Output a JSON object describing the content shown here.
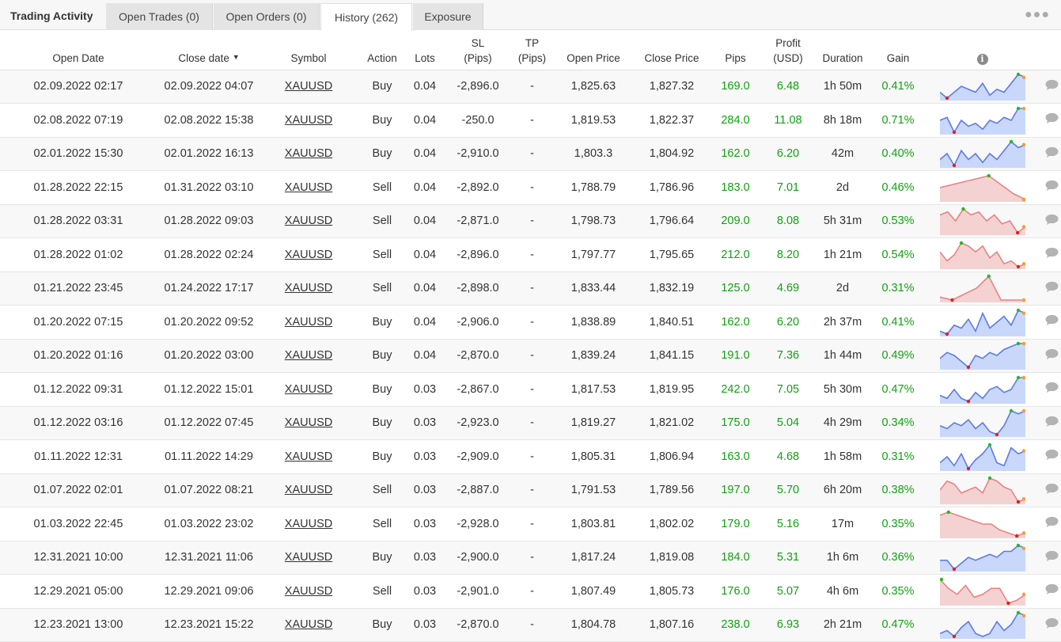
{
  "brand": "Trading Activity",
  "tabs": [
    {
      "label": "Open Trades (0)"
    },
    {
      "label": "Open Orders (0)"
    },
    {
      "label": "History (262)"
    },
    {
      "label": "Exposure"
    }
  ],
  "menu_icon": "more-horizontal-icon",
  "headers": {
    "open_date": "Open Date",
    "close_date": "Close date",
    "sort_indicator": "▼",
    "symbol": "Symbol",
    "action": "Action",
    "lots": "Lots",
    "sl": "SL",
    "sl_unit": "(Pips)",
    "tp": "TP",
    "tp_unit": "(Pips)",
    "open_price": "Open Price",
    "close_price": "Close Price",
    "pips": "Pips",
    "profit": "Profit",
    "profit_unit": "(USD)",
    "duration": "Duration",
    "gain": "Gain",
    "info": "i"
  },
  "colors": {
    "profit_green": "#12a012",
    "buy_line": "#5b7be8",
    "buy_fill": "#c9d7fb",
    "sell_line": "#e88383",
    "sell_fill": "#f4d2d2",
    "max_dot": "#22bb22",
    "min_dot": "#e02020",
    "end_dot": "#ff9933",
    "chat_icon": "#b3b3b3"
  },
  "rows": [
    {
      "open": "02.09.2022 02:17",
      "close": "02.09.2022 04:07",
      "symbol": "XAUUSD",
      "action": "Buy",
      "lots": "0.04",
      "sl": "-2,896.0",
      "tp": "-",
      "open_price": "1,825.63",
      "close_price": "1,827.32",
      "pips": "169.0",
      "profit": "6.48",
      "duration": "1h 50m",
      "gain": "0.41%",
      "spark": [
        3,
        1,
        3,
        5,
        4,
        3,
        6,
        2,
        4,
        3,
        6,
        9,
        8
      ]
    },
    {
      "open": "02.08.2022 07:19",
      "close": "02.08.2022 15:38",
      "symbol": "XAUUSD",
      "action": "Buy",
      "lots": "0.04",
      "sl": "-250.0",
      "tp": "-",
      "open_price": "1,819.53",
      "close_price": "1,822.37",
      "pips": "284.0",
      "profit": "11.08",
      "duration": "8h 18m",
      "gain": "0.71%",
      "spark": [
        5,
        6,
        1,
        5,
        3,
        4,
        2,
        5,
        4,
        6,
        5,
        9,
        9
      ]
    },
    {
      "open": "02.01.2022 15:30",
      "close": "02.01.2022 16:13",
      "symbol": "XAUUSD",
      "action": "Buy",
      "lots": "0.04",
      "sl": "-2,910.0",
      "tp": "-",
      "open_price": "1,803.3",
      "close_price": "1,804.92",
      "pips": "162.0",
      "profit": "6.20",
      "duration": "42m",
      "gain": "0.40%",
      "spark": [
        3,
        5,
        1,
        6,
        3,
        5,
        2,
        5,
        3,
        6,
        9,
        7,
        8
      ]
    },
    {
      "open": "01.28.2022 22:15",
      "close": "01.31.2022 03:10",
      "symbol": "XAUUSD",
      "action": "Sell",
      "lots": "0.04",
      "sl": "-2,892.0",
      "tp": "-",
      "open_price": "1,788.79",
      "close_price": "1,786.96",
      "pips": "183.0",
      "profit": "7.01",
      "duration": "2d",
      "gain": "0.46%",
      "spark": [
        5,
        6,
        7,
        8,
        9,
        6,
        3,
        1
      ]
    },
    {
      "open": "01.28.2022 03:31",
      "close": "01.28.2022 09:03",
      "symbol": "XAUUSD",
      "action": "Sell",
      "lots": "0.04",
      "sl": "-2,871.0",
      "tp": "-",
      "open_price": "1,798.73",
      "close_price": "1,796.64",
      "pips": "209.0",
      "profit": "8.08",
      "duration": "5h 31m",
      "gain": "0.53%",
      "spark": [
        7,
        8,
        5,
        9,
        7,
        8,
        5,
        7,
        4,
        5,
        1,
        3
      ]
    },
    {
      "open": "01.28.2022 01:02",
      "close": "01.28.2022 02:24",
      "symbol": "XAUUSD",
      "action": "Sell",
      "lots": "0.04",
      "sl": "-2,896.0",
      "tp": "-",
      "open_price": "1,797.77",
      "close_price": "1,795.65",
      "pips": "212.0",
      "profit": "8.20",
      "duration": "1h 21m",
      "gain": "0.54%",
      "spark": [
        6,
        3,
        5,
        9,
        8,
        6,
        8,
        4,
        6,
        2,
        3,
        1,
        2
      ]
    },
    {
      "open": "01.21.2022 23:45",
      "close": "01.24.2022 17:17",
      "symbol": "XAUUSD",
      "action": "Sell",
      "lots": "0.04",
      "sl": "-2,898.0",
      "tp": "-",
      "open_price": "1,833.44",
      "close_price": "1,832.19",
      "pips": "125.0",
      "profit": "4.69",
      "duration": "2d",
      "gain": "0.31%",
      "spark": [
        2,
        1,
        3,
        5,
        9,
        1,
        1,
        1
      ]
    },
    {
      "open": "01.20.2022 07:15",
      "close": "01.20.2022 09:52",
      "symbol": "XAUUSD",
      "action": "Buy",
      "lots": "0.04",
      "sl": "-2,906.0",
      "tp": "-",
      "open_price": "1,838.89",
      "close_price": "1,840.51",
      "pips": "162.0",
      "profit": "6.20",
      "duration": "2h 37m",
      "gain": "0.41%",
      "spark": [
        2,
        1,
        4,
        3,
        6,
        2,
        8,
        3,
        5,
        7,
        4,
        9,
        8
      ]
    },
    {
      "open": "01.20.2022 01:16",
      "close": "01.20.2022 03:00",
      "symbol": "XAUUSD",
      "action": "Buy",
      "lots": "0.04",
      "sl": "-2,870.0",
      "tp": "-",
      "open_price": "1,839.24",
      "close_price": "1,841.15",
      "pips": "191.0",
      "profit": "7.36",
      "duration": "1h 44m",
      "gain": "0.49%",
      "spark": [
        4,
        6,
        5,
        3,
        1,
        5,
        4,
        6,
        5,
        7,
        8,
        9,
        9
      ]
    },
    {
      "open": "01.12.2022 09:31",
      "close": "01.12.2022 15:01",
      "symbol": "XAUUSD",
      "action": "Buy",
      "lots": "0.03",
      "sl": "-2,867.0",
      "tp": "-",
      "open_price": "1,817.53",
      "close_price": "1,819.95",
      "pips": "242.0",
      "profit": "7.05",
      "duration": "5h 30m",
      "gain": "0.47%",
      "spark": [
        3,
        2,
        5,
        2,
        1,
        4,
        2,
        5,
        6,
        4,
        5,
        9,
        9
      ]
    },
    {
      "open": "01.12.2022 03:16",
      "close": "01.12.2022 07:45",
      "symbol": "XAUUSD",
      "action": "Buy",
      "lots": "0.03",
      "sl": "-2,923.0",
      "tp": "-",
      "open_price": "1,819.27",
      "close_price": "1,821.02",
      "pips": "175.0",
      "profit": "5.04",
      "duration": "4h 29m",
      "gain": "0.34%",
      "spark": [
        4,
        3,
        5,
        4,
        6,
        3,
        5,
        2,
        1,
        4,
        9,
        8,
        9
      ]
    },
    {
      "open": "01.11.2022 12:31",
      "close": "01.11.2022 14:29",
      "symbol": "XAUUSD",
      "action": "Buy",
      "lots": "0.03",
      "sl": "-2,909.0",
      "tp": "-",
      "open_price": "1,805.31",
      "close_price": "1,806.94",
      "pips": "163.0",
      "profit": "4.68",
      "duration": "1h 58m",
      "gain": "0.31%",
      "spark": [
        3,
        5,
        2,
        6,
        1,
        4,
        6,
        9,
        3,
        2,
        8,
        6,
        7
      ]
    },
    {
      "open": "01.07.2022 02:01",
      "close": "01.07.2022 08:21",
      "symbol": "XAUUSD",
      "action": "Sell",
      "lots": "0.03",
      "sl": "-2,887.0",
      "tp": "-",
      "open_price": "1,791.53",
      "close_price": "1,789.56",
      "pips": "197.0",
      "profit": "5.70",
      "duration": "6h 20m",
      "gain": "0.38%",
      "spark": [
        5,
        8,
        7,
        4,
        5,
        6,
        4,
        9,
        8,
        6,
        5,
        1,
        2
      ]
    },
    {
      "open": "01.03.2022 22:45",
      "close": "01.03.2022 23:02",
      "symbol": "XAUUSD",
      "action": "Sell",
      "lots": "0.03",
      "sl": "-2,928.0",
      "tp": "-",
      "open_price": "1,803.81",
      "close_price": "1,802.02",
      "pips": "179.0",
      "profit": "5.16",
      "duration": "17m",
      "gain": "0.35%",
      "spark": [
        8,
        9,
        8,
        7,
        6,
        5,
        5,
        3,
        2,
        1,
        2
      ]
    },
    {
      "open": "12.31.2021 10:00",
      "close": "12.31.2021 11:06",
      "symbol": "XAUUSD",
      "action": "Buy",
      "lots": "0.03",
      "sl": "-2,900.0",
      "tp": "-",
      "open_price": "1,817.24",
      "close_price": "1,819.08",
      "pips": "184.0",
      "profit": "5.31",
      "duration": "1h 6m",
      "gain": "0.36%",
      "spark": [
        4,
        4,
        1,
        3,
        5,
        4,
        5,
        6,
        5,
        7,
        7,
        9,
        8
      ]
    },
    {
      "open": "12.29.2021 05:00",
      "close": "12.29.2021 09:06",
      "symbol": "XAUUSD",
      "action": "Sell",
      "lots": "0.03",
      "sl": "-2,901.0",
      "tp": "-",
      "open_price": "1,807.49",
      "close_price": "1,805.73",
      "pips": "176.0",
      "profit": "5.07",
      "duration": "4h 6m",
      "gain": "0.35%",
      "spark": [
        9,
        6,
        4,
        7,
        3,
        4,
        6,
        6,
        1,
        2,
        4
      ]
    },
    {
      "open": "12.23.2021 13:00",
      "close": "12.23.2021 15:22",
      "symbol": "XAUUSD",
      "action": "Buy",
      "lots": "0.03",
      "sl": "-2,870.0",
      "tp": "-",
      "open_price": "1,804.78",
      "close_price": "1,807.16",
      "pips": "238.0",
      "profit": "6.93",
      "duration": "2h 21m",
      "gain": "0.47%",
      "spark": [
        2,
        3,
        1,
        4,
        6,
        2,
        1,
        2,
        6,
        3,
        5,
        9,
        8
      ]
    }
  ]
}
